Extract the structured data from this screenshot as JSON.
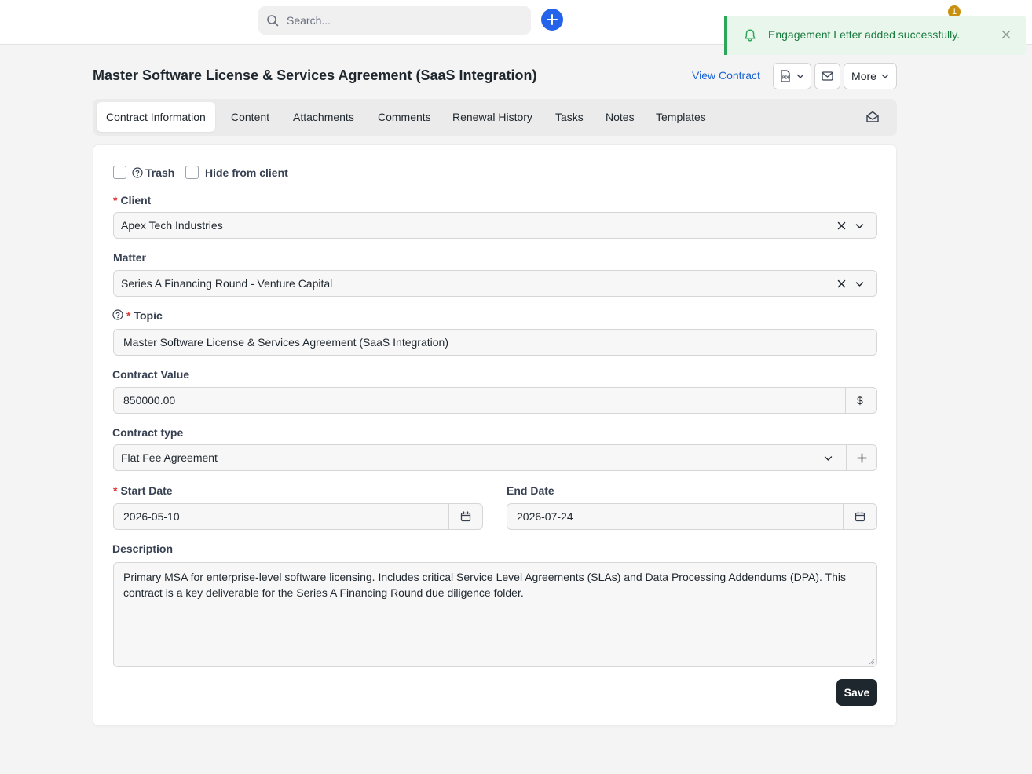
{
  "navbar": {
    "search_placeholder": "Search...",
    "notification_count": "1"
  },
  "toast": {
    "message": "Engagement Letter added successfully."
  },
  "header": {
    "title": "Master Software License & Services Agreement (SaaS Integration)",
    "view_contract": "View Contract",
    "more_label": "More"
  },
  "tabs": [
    {
      "label": "Contract Information"
    },
    {
      "label": "Content"
    },
    {
      "label": "Attachments"
    },
    {
      "label": "Comments"
    },
    {
      "label": "Renewal History"
    },
    {
      "label": "Tasks"
    },
    {
      "label": "Notes"
    },
    {
      "label": "Templates"
    }
  ],
  "form": {
    "trash_label": "Trash",
    "hide_label": "Hide from client",
    "client": {
      "label": "Client",
      "value": "Apex Tech Industries"
    },
    "matter": {
      "label": "Matter",
      "value": "Series A Financing Round - Venture Capital"
    },
    "topic": {
      "label": "Topic",
      "value": "Master Software License & Services Agreement (SaaS Integration)"
    },
    "contract_value": {
      "label": "Contract Value",
      "value": "850000.00",
      "currency": "$"
    },
    "contract_type": {
      "label": "Contract type",
      "value": "Flat Fee Agreement"
    },
    "start_date": {
      "label": "Start Date",
      "value": "2026-05-10"
    },
    "end_date": {
      "label": "End Date",
      "value": "2026-07-24"
    },
    "description": {
      "label": "Description",
      "value": "Primary MSA for enterprise-level software licensing. Includes critical Service Level Agreements (SLAs) and Data Processing Addendums (DPA). This contract is a key deliverable for the Series A Financing Round due diligence folder."
    },
    "save_label": "Save"
  },
  "colors": {
    "accent": "#2563eb",
    "success": "#157a3c",
    "required": "#e03636",
    "primary_button": "#1f272e"
  }
}
